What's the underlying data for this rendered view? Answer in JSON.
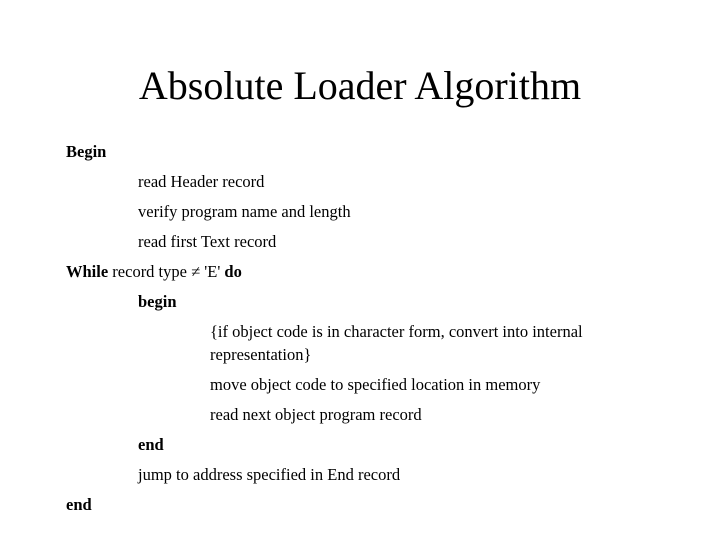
{
  "title": "Absolute Loader Algorithm",
  "lines": {
    "begin": "Begin",
    "read_header": "read Header record",
    "verify": "verify program name and length",
    "read_first_text": "read first Text record",
    "while_prefix": "While",
    "while_cond": " record type ≠ 'E' ",
    "while_do": "do",
    "begin_inner": "begin",
    "if_convert": "{if object code is in character form, convert into internal representation}",
    "move_obj": "move object code to specified location in memory",
    "read_next": "read next object program record",
    "end_inner": "end",
    "jump": "jump to address specified in End record",
    "end": "end"
  }
}
